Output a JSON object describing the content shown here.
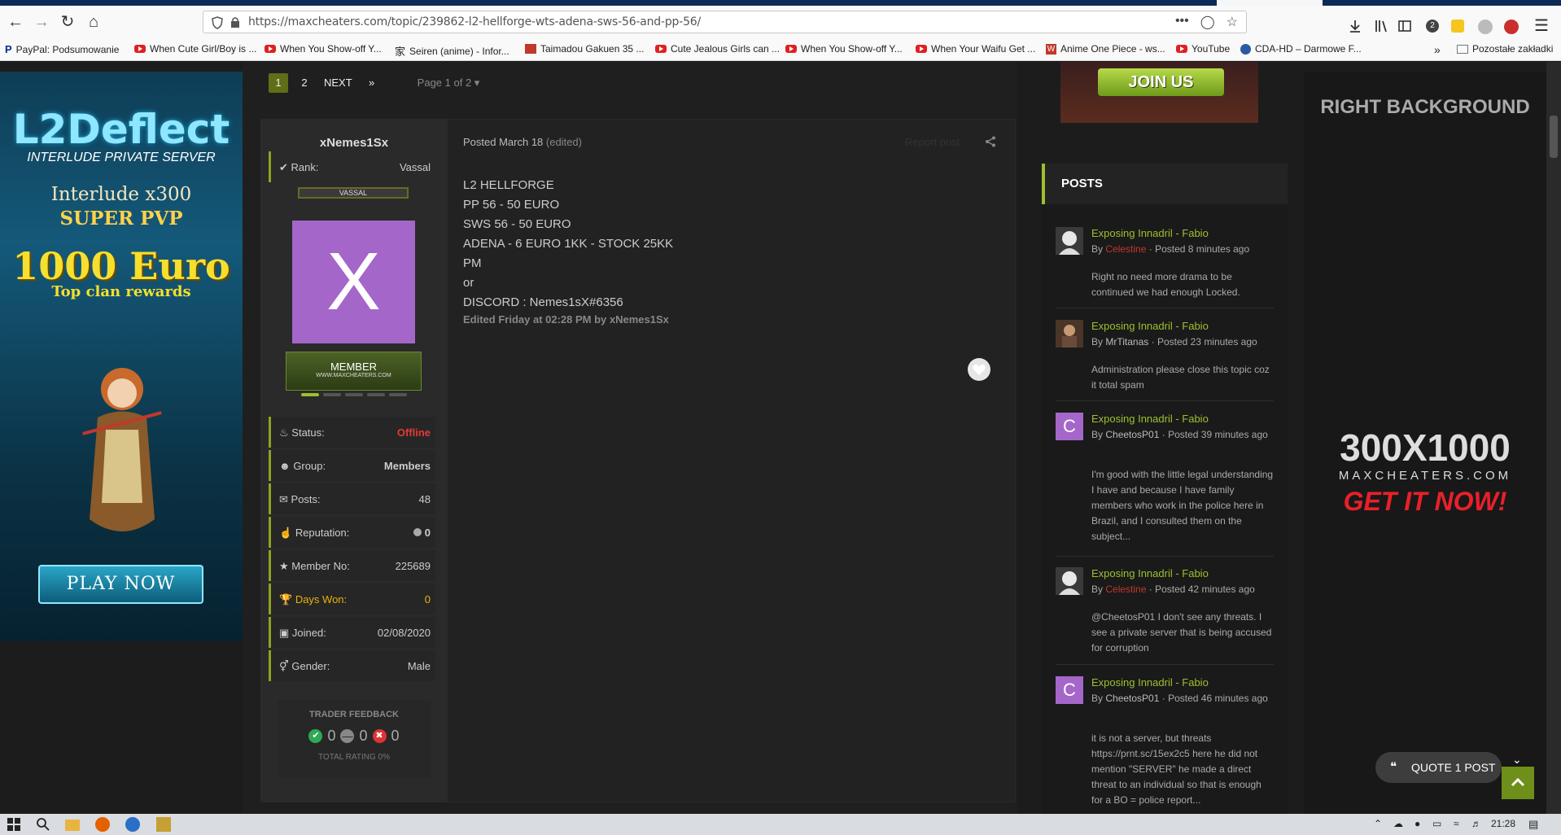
{
  "browser": {
    "url": "https://maxcheaters.com/topic/239862-l2-hellforge-wts-adena-sws-56-and-pp-56/",
    "notification_count": "2",
    "bookmarks": [
      "PayPal: Podsumowanie",
      "When Cute Girl/Boy is ...",
      "When You Show-off Y...",
      "Seiren (anime) - Infor...",
      "Taimadou Gakuen 35 ...",
      "Cute Jealous Girls can ...",
      "When You Show-off Y...",
      "When Your Waifu Get ...",
      "Anime One Piece - ws...",
      "YouTube",
      "CDA-HD – Darmowe F..."
    ],
    "other_bookmarks": "Pozostałe zakładki"
  },
  "left_ad": {
    "brand": "L2Deflect",
    "subtitle": "INTERLUDE PRIVATE SERVER",
    "rates": "Interlude x300",
    "pvp": "SUPER PVP",
    "prize": "1000 Euro",
    "prize_sub": "Top clan rewards",
    "play_label": "PLAY NOW"
  },
  "pagination": {
    "pages": [
      "1",
      "2"
    ],
    "next": "NEXT",
    "info": "Page 1 of 2"
  },
  "author": {
    "name": "xNemes1Sx",
    "rank_label": "Rank:",
    "rank_value": "Vassal",
    "rank_badge": "VASSAL",
    "avatar_letter": "X",
    "member_badge": "MEMBER",
    "member_badge_site": "WWW.MAXCHEATERS.COM",
    "stats": [
      {
        "label": "Status:",
        "value": "Offline"
      },
      {
        "label": "Group:",
        "value": "Members"
      },
      {
        "label": "Posts:",
        "value": "48"
      },
      {
        "label": "Reputation:",
        "value": "0"
      },
      {
        "label": "Member No:",
        "value": "225689"
      },
      {
        "label": "Days Won:",
        "value": "0"
      },
      {
        "label": "Joined:",
        "value": "02/08/2020"
      },
      {
        "label": "Gender:",
        "value": "Male"
      }
    ],
    "feedback": {
      "title": "TRADER FEEDBACK",
      "positive": "0",
      "neutral": "0",
      "negative": "0",
      "total": "TOTAL RATING 0%"
    }
  },
  "post": {
    "posted": "Posted March 18",
    "edited_tag": "(edited)",
    "report": "Report post",
    "lines": [
      "L2 HELLFORGE",
      "PP 56 - 50 EURO",
      "SWS 56 - 50 EURO",
      "ADENA - 6 EURO 1KK - STOCK 25KK",
      "PM",
      "or",
      "DISCORD : Nemes1sX#6356"
    ],
    "edited_note": "Edited Friday at 02:28 PM by xNemes1Sx"
  },
  "join_banner": {
    "label": "JOIN US"
  },
  "widget": {
    "title": "POSTS",
    "items": [
      {
        "title": "Exposing Innadril - Fabio",
        "by": "By",
        "author": "Celestine",
        "time": "· Posted 8 minutes ago",
        "excerpt": "Right no need more drama to be continued we had enough  Locked."
      },
      {
        "title": "Exposing Innadril - Fabio",
        "by": "By",
        "author": "MrTitanas",
        "time": "· Posted 23 minutes ago",
        "excerpt": "Administration please close this topic coz it total spam"
      },
      {
        "title": "Exposing Innadril - Fabio",
        "by": "By",
        "author": "CheetosP01",
        "time": "· Posted 39 minutes ago",
        "excerpt": "I'm good with the little legal understanding I have and because I have family members who work in the police here in Brazil, and I consulted them on the subject..."
      },
      {
        "title": "Exposing Innadril - Fabio",
        "by": "By",
        "author": "Celestine",
        "time": "· Posted 42 minutes ago",
        "excerpt": "@CheetosP01 I don't see any threats. I see a private server that is being accused for corruption"
      },
      {
        "title": "Exposing Innadril - Fabio",
        "by": "By",
        "author": "CheetosP01",
        "time": "· Posted 46 minutes ago",
        "excerpt": "it is not a server, but threats https://prnt.sc/15ex2c5 here he did not mention \"SERVER\" he made a direct threat to an individual so that is enough for a BO = police report..."
      }
    ]
  },
  "right_ad": {
    "heading": "RIGHT BACKGROUND",
    "size": "300X1000",
    "site": "MAXCHEATERS.COM",
    "cta": "GET IT NOW!"
  },
  "quote_button": "QUOTE 1 POST",
  "taskbar": {
    "time": "21:28"
  },
  "colors": {
    "accent": "#9dbf2f",
    "offline": "#e53935",
    "days_won": "#e8b20c",
    "avatar": "#a566c9"
  }
}
